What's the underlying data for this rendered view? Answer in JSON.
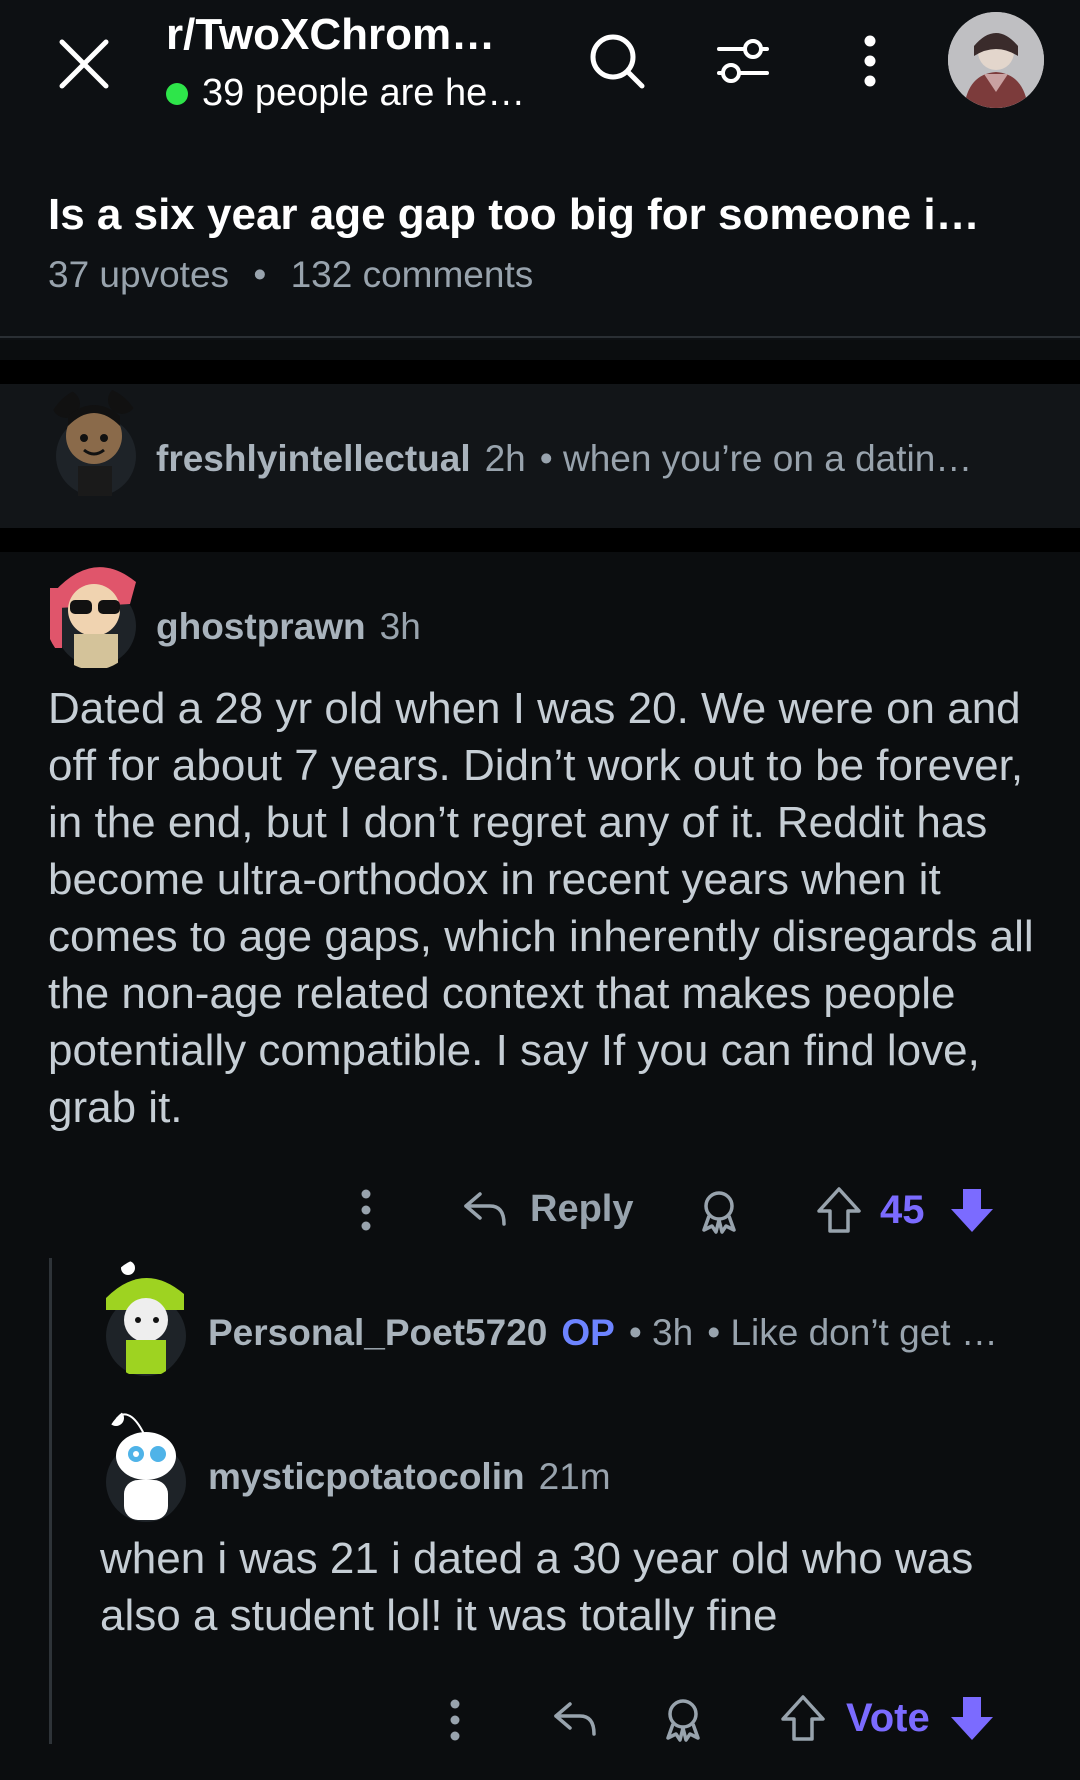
{
  "header": {
    "subreddit": "r/TwoXChrom…",
    "online_text": "39 people are he…",
    "icons": [
      "close-icon",
      "search-icon",
      "filter-icon",
      "more-vertical-icon",
      "avatar"
    ]
  },
  "post": {
    "title": "Is a six year age gap too big for someone i…",
    "upvotes": "37 upvotes",
    "separator": "•",
    "comments": "132 comments"
  },
  "comments": {
    "c1": {
      "username": "freshlyintellectual",
      "time": "2h",
      "preview": "• when you’re on a datin…"
    },
    "c2": {
      "username": "ghostprawn",
      "time": "3h",
      "body": "Dated a 28 yr old when I was 20. We were on and off for about 7 years. Didn’t work out to be forever, in the end, but I don’t regret any of it. Reddit has become ultra-orthodox in recent years when it comes to age gaps, which inherently disregards all the non-age related context that makes people potentially compatible. I say If you can find love, grab it.",
      "reply_label": "Reply",
      "votes": "45"
    },
    "c3": {
      "username": "Personal_Poet5720",
      "op_badge": "OP",
      "time": "• 3h",
      "preview": "• Like don’t get …"
    },
    "c4": {
      "username": "mysticpotatocolin",
      "time": "21m",
      "body": "when i was 21 i dated a 30 year old who was also a student lol! it was totally fine",
      "vote_label": "Vote"
    }
  },
  "colors": {
    "background": "#0b0d0f",
    "accent_vote": "#7b6bff",
    "online": "#2ee54a",
    "op": "#6d84ff"
  }
}
